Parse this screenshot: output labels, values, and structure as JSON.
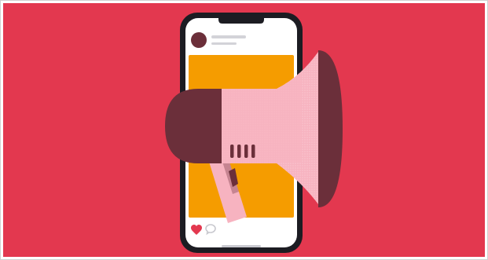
{
  "illustration": {
    "icons": {
      "phone": "smartphone-icon",
      "megaphone": "megaphone-icon",
      "like": "heart-icon",
      "comment": "speech-bubble-icon"
    },
    "colors": {
      "background": "#E3384F",
      "phone_body": "#1C1C22",
      "screen": "#FFFFFF",
      "post_image": "#F59C00",
      "avatar": "#6B2F3A",
      "placeholder_line": "#D3D3D8",
      "megaphone_pink": "#F7B3C0",
      "megaphone_dark": "#6B2F3A",
      "handle": "#F7B3C0",
      "heart": "#E3384F",
      "comment": "#C9C9CF",
      "home_indicator": "#C9C9CF",
      "border": "#D0D0D0"
    }
  }
}
